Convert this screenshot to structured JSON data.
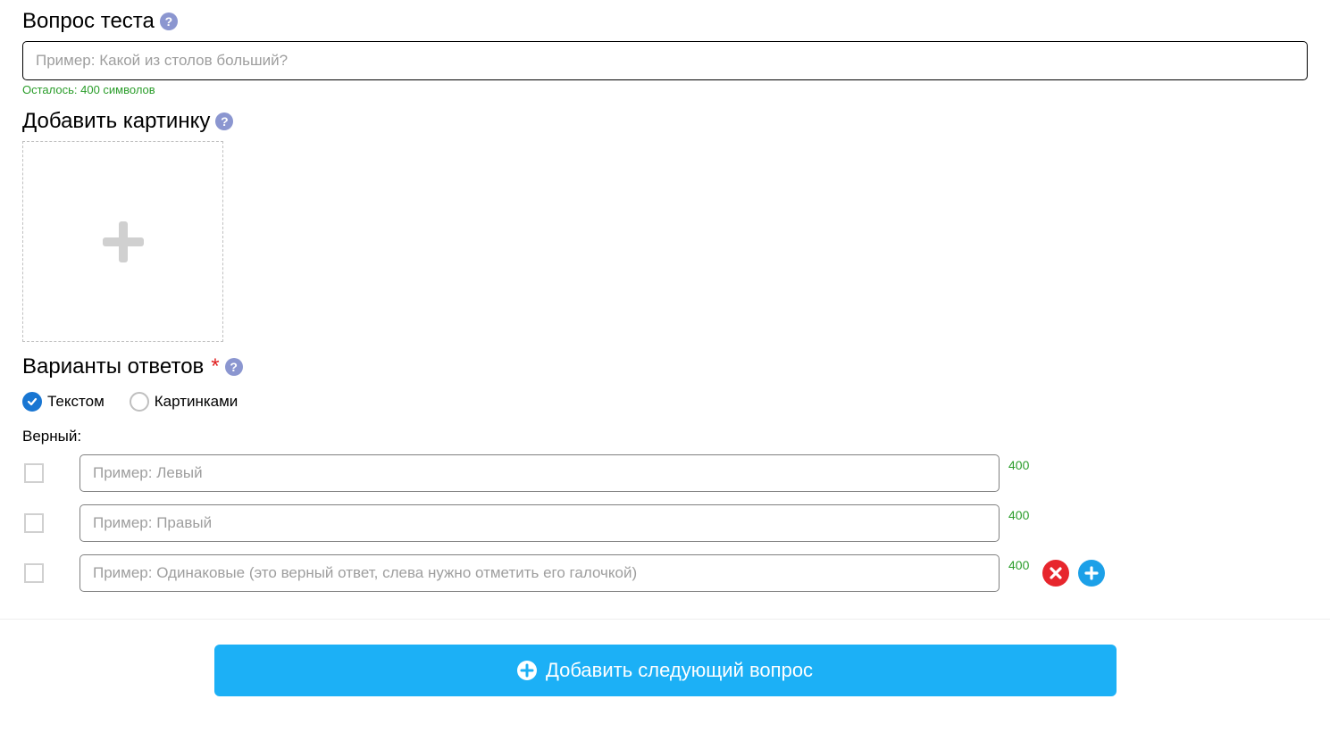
{
  "question": {
    "heading": "Вопрос теста",
    "placeholder": "Пример: Какой из столов больший?",
    "counter": "Осталось: 400 символов"
  },
  "image": {
    "heading": "Добавить картинку"
  },
  "answers": {
    "heading": "Варианты ответов",
    "mode_text": "Текстом",
    "mode_images": "Картинками",
    "correct_label": "Верный:",
    "rows": [
      {
        "placeholder": "Пример: Левый",
        "count": "400"
      },
      {
        "placeholder": "Пример: Правый",
        "count": "400"
      },
      {
        "placeholder": "Пример: Одинаковые (это верный ответ, слева нужно отметить его галочкой)",
        "count": "400"
      }
    ]
  },
  "add_button": "Добавить следующий вопрос",
  "help_glyph": "?"
}
